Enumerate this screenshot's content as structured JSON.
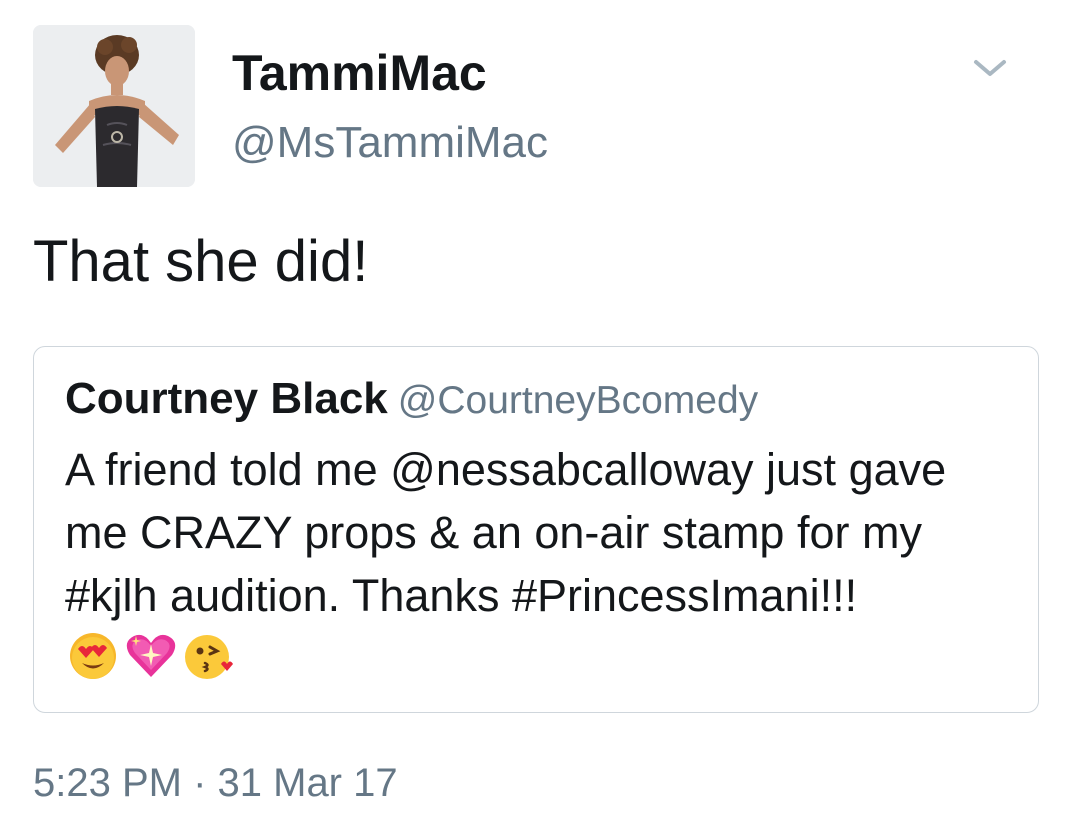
{
  "tweet": {
    "author": {
      "display_name": "TammiMac",
      "handle": "@MsTammiMac"
    },
    "text": "That she did!",
    "timestamp": "5:23 PM · 31 Mar 17",
    "quoted_tweet": {
      "display_name": "Courtney Black",
      "handle": "@CourtneyBcomedy",
      "text_lines": [
        "A friend told me @nessabcalloway just gave",
        "me CRAZY props & an on-air stamp for my",
        "#kjlh audition. Thanks #PrincessImani!!!"
      ],
      "emojis": [
        "heart-eyes-emoji",
        "sparkling-heart-emoji",
        "kissing-face-emoji"
      ]
    }
  },
  "icons": {
    "menu": "chevron-down-icon"
  },
  "colors": {
    "text_primary": "#14171a",
    "text_secondary": "#657786",
    "card_border": "#cfd6dc",
    "background": "#ffffff"
  }
}
